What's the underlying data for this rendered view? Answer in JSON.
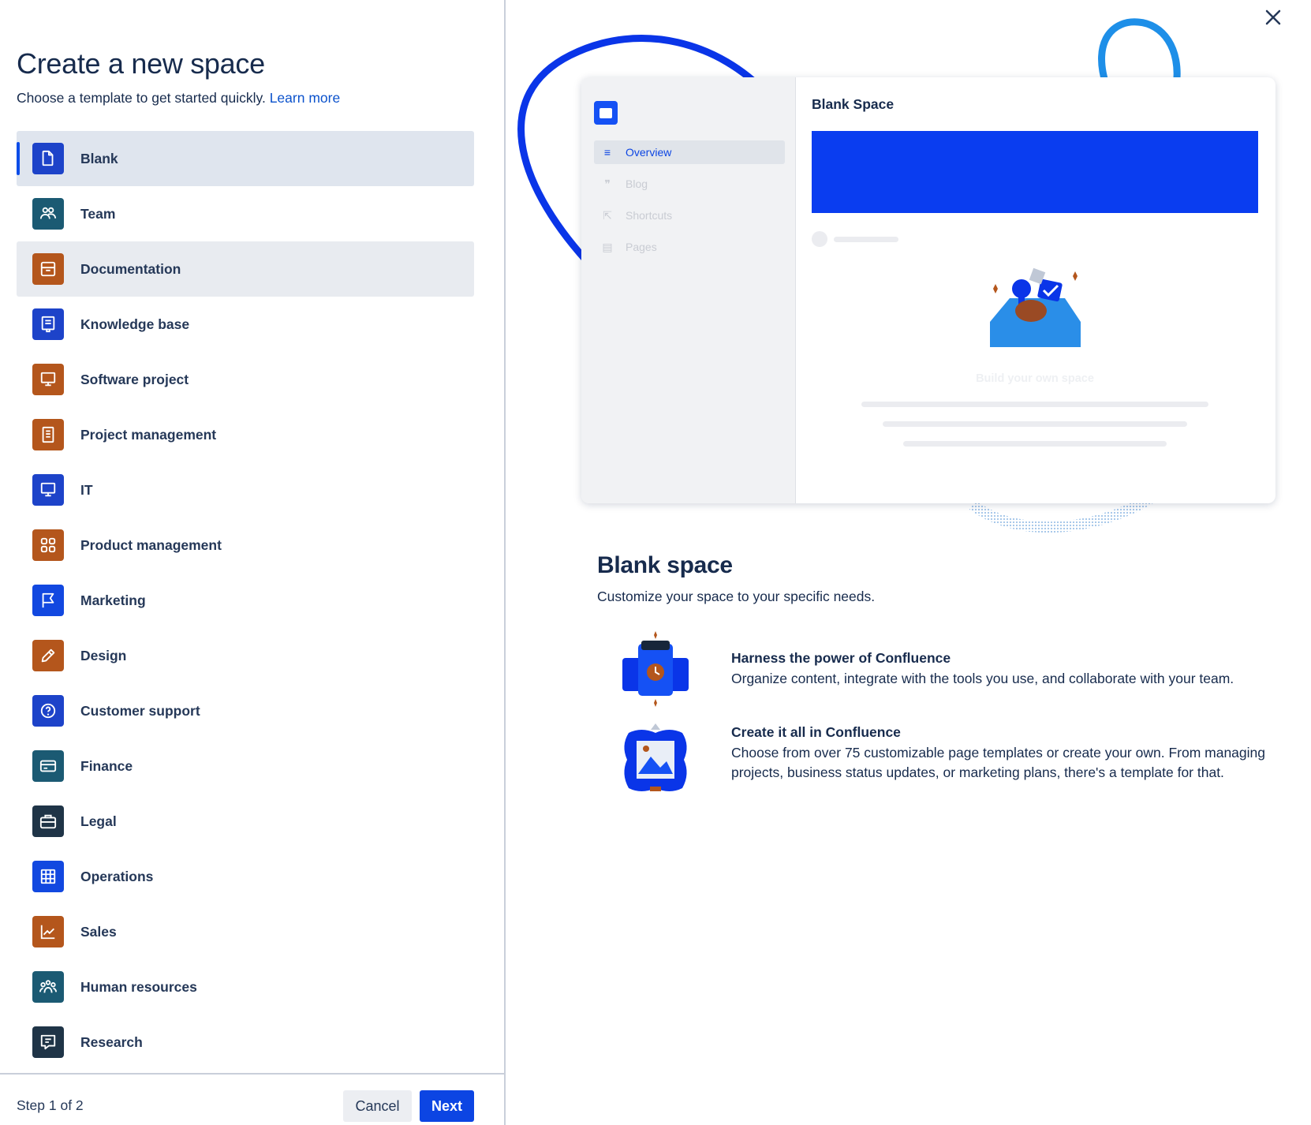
{
  "header": {
    "title": "Create a new space",
    "subtitle": "Choose a template to get started quickly.",
    "learn_more": "Learn more"
  },
  "templates": [
    {
      "label": "Blank",
      "icon": "page-icon",
      "color": "#1d43c9",
      "state": "selected"
    },
    {
      "label": "Team",
      "icon": "people-icon",
      "color": "#1b5a73"
    },
    {
      "label": "Documentation",
      "icon": "archive-icon",
      "color": "#b4561c",
      "state": "hover"
    },
    {
      "label": "Knowledge base",
      "icon": "book-icon",
      "color": "#1d43c9"
    },
    {
      "label": "Software project",
      "icon": "monitor-icon",
      "color": "#b4561c"
    },
    {
      "label": "Project management",
      "icon": "document-icon",
      "color": "#b4561c"
    },
    {
      "label": "IT",
      "icon": "monitor-icon",
      "color": "#1d43c9"
    },
    {
      "label": "Product management",
      "icon": "grid-icon",
      "color": "#b4561c"
    },
    {
      "label": "Marketing",
      "icon": "flag-icon",
      "color": "#1248e0"
    },
    {
      "label": "Design",
      "icon": "pencil-icon",
      "color": "#b4561c"
    },
    {
      "label": "Customer support",
      "icon": "help-icon",
      "color": "#1d43c9"
    },
    {
      "label": "Finance",
      "icon": "credit-card-icon",
      "color": "#1b5a73"
    },
    {
      "label": "Legal",
      "icon": "briefcase-icon",
      "color": "#1f3447"
    },
    {
      "label": "Operations",
      "icon": "table-icon",
      "color": "#1248e0"
    },
    {
      "label": "Sales",
      "icon": "chart-icon",
      "color": "#b4561c"
    },
    {
      "label": "Human resources",
      "icon": "group-icon",
      "color": "#1b5a73"
    },
    {
      "label": "Research",
      "icon": "feedback-icon",
      "color": "#1f3447"
    }
  ],
  "footer": {
    "step": "Step 1 of 2",
    "cancel": "Cancel",
    "next": "Next"
  },
  "preview": {
    "space_title": "Blank Space",
    "nav": [
      "Overview",
      "Blog",
      "Shortcuts",
      "Pages"
    ],
    "build_text": "Build your own space"
  },
  "details": {
    "title": "Blank space",
    "subtitle": "Customize your space to your specific needs.",
    "features": [
      {
        "heading": "Harness the power of Confluence",
        "text": "Organize content, integrate with the tools you use, and collaborate with your team."
      },
      {
        "heading": "Create it all in Confluence",
        "text": "Choose from over 75 customizable page templates or create your own. From managing projects, business status updates, or marketing plans, there's a template for that."
      }
    ]
  },
  "colors": {
    "accent": "#0c45e3",
    "selected_bg": "#dfe5ee",
    "text": "#172b4d"
  }
}
